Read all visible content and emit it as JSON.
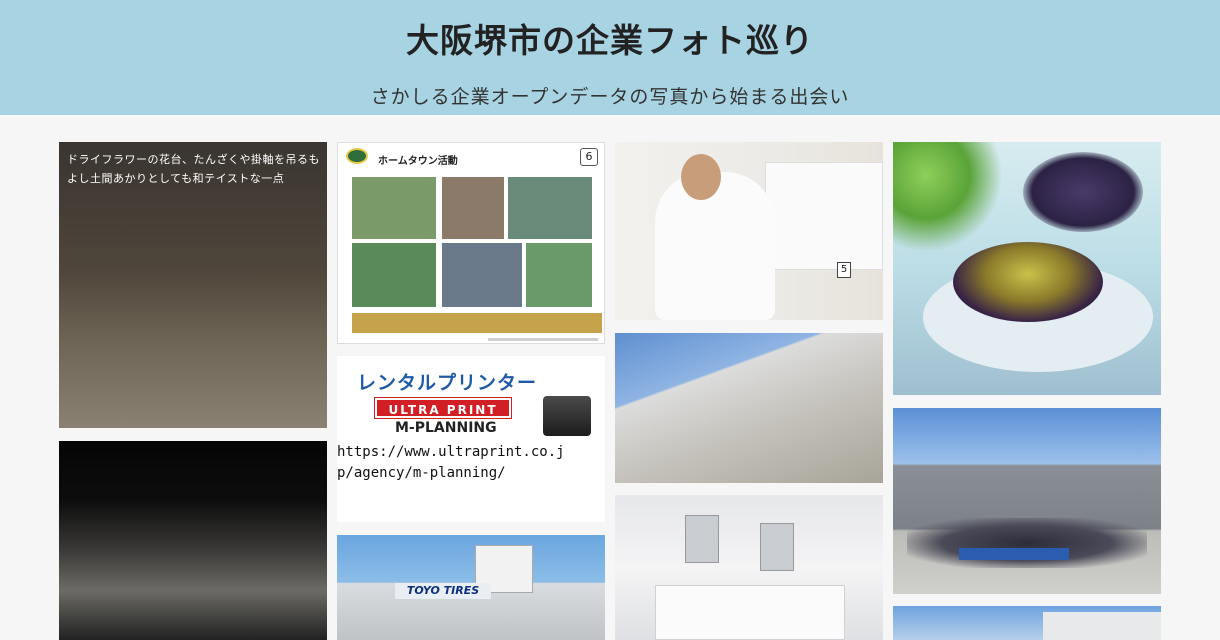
{
  "header": {
    "title": "大阪堺市の企業フォト巡り",
    "subtitle": "さかしる企業オープンデータの写真から始まる出会い"
  },
  "tiles": {
    "t1": {
      "caption": "ドライフラワーの花台、たんざくや掛軸を吊るもよし土間あかりとしても和テイストな一点"
    },
    "t3": {
      "heading": "ホームタウン活動",
      "number": "6"
    },
    "t4": {
      "title": "レンタルプリンター",
      "badge": "ULTRA PRINT",
      "subtitle": "M-PLANNING",
      "url": "https://www.ultraprint.co.jp/agency/m-planning/"
    },
    "t5": {
      "sign": "TOYO TIRES"
    },
    "t6": {
      "number": "5"
    }
  },
  "colors": {
    "header_bg": "#a8d3e3",
    "page_bg": "#f6f6f7"
  }
}
